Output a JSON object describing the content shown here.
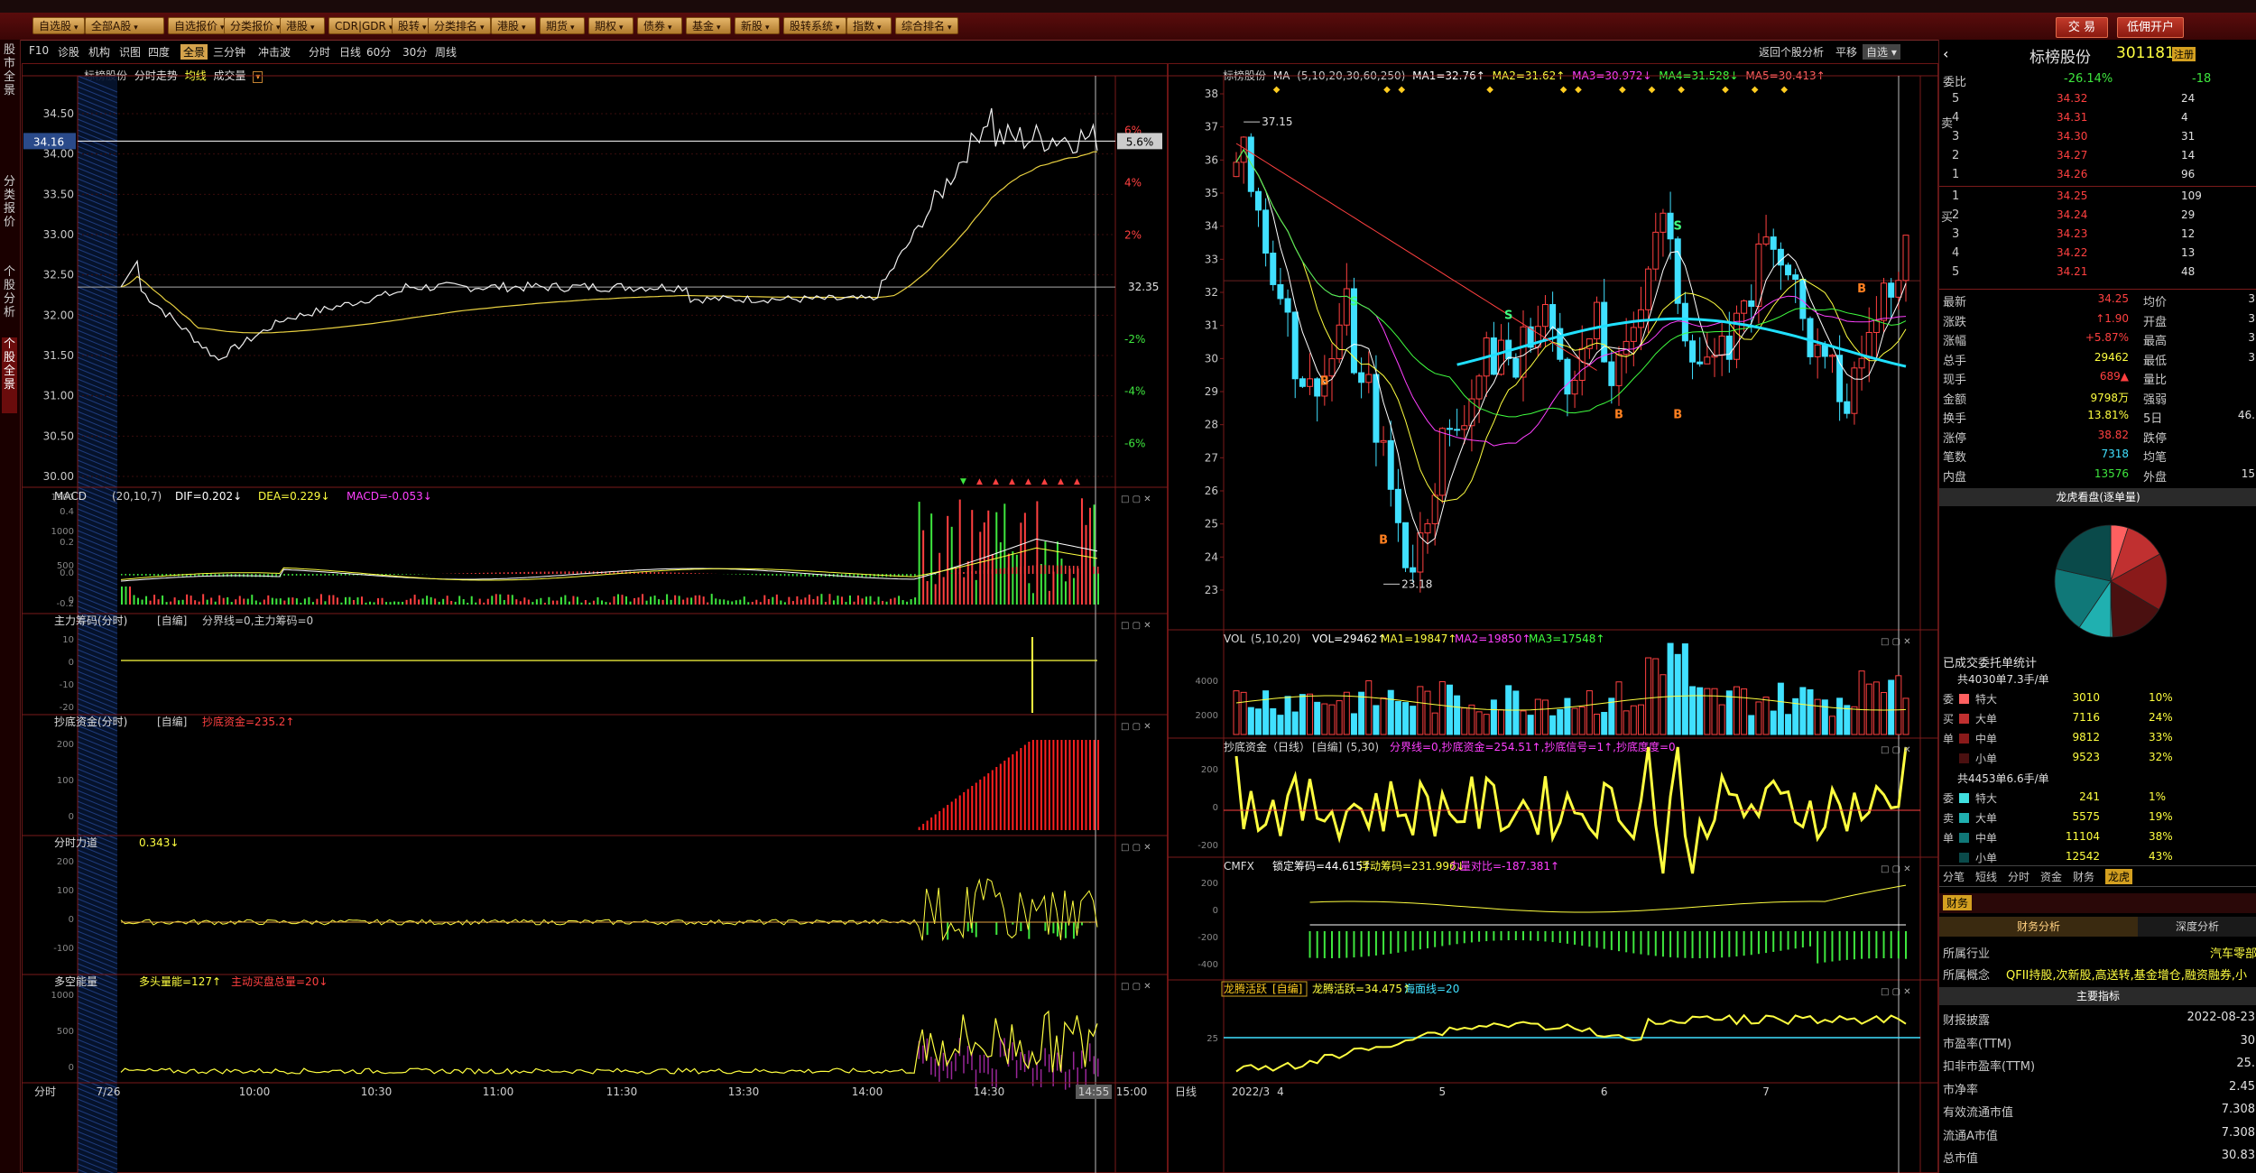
{
  "toolbar": {
    "buttons": [
      "自选股",
      "全部A股",
      "自选报价",
      "分类报价",
      "港股",
      "CDR|GDR",
      "股转",
      "分类排名",
      "港股",
      "期货",
      "期权",
      "债券",
      "基金",
      "新股",
      "股转系统",
      "指数",
      "综合排名"
    ],
    "trade_label": "交 易",
    "margin_label": "低佣开户"
  },
  "sidebar": {
    "tabs": [
      "股市全景",
      "分类报价",
      "个股分析",
      "个股全景"
    ],
    "active_index": 3
  },
  "subnav": {
    "left_items": [
      "F10",
      "诊股",
      "机构",
      "识图",
      "四度",
      "全景",
      "三分钟",
      "冲击波",
      "分时",
      "日线",
      "60分",
      "30分",
      "周线"
    ],
    "selected": "全景",
    "right_items": [
      "返回个股分析",
      "平移",
      "自选"
    ]
  },
  "intraday": {
    "title": "标榜股份",
    "subtitle": "分时走势",
    "avg_label": "均线",
    "vol_label": "成交量",
    "current_price": "34.16",
    "current_pct": "5.6%",
    "price_ticks": [
      "34.50",
      "34.00",
      "33.50",
      "33.00",
      "32.50",
      "32.00",
      "31.50",
      "31.00",
      "30.50",
      "30.00"
    ],
    "pct_ticks": [
      "6%",
      "4%",
      "2%",
      "-2%",
      "-4%",
      "-6%"
    ],
    "prev_close": "32.35",
    "time_labels": [
      "7/26",
      "10:00",
      "10:30",
      "11:00",
      "11:30",
      "13:30",
      "14:00",
      "14:30",
      "14:55",
      "15:00"
    ],
    "time_left_label": "分时"
  },
  "vol_panel": {
    "ticks": [
      "1500",
      "1000",
      "500",
      "0"
    ]
  },
  "macd_panel": {
    "label": "MACD",
    "params": "(20,10,7)",
    "dif": "DIF=0.202↓",
    "dea": "DEA=0.229↓",
    "macd": "MACD=-0.053↓",
    "ticks": [
      "0.4",
      "0.2",
      "0.0",
      "-0.2"
    ]
  },
  "zljm_panel": {
    "label": "主力筹码(分时)",
    "mode": "[自编]",
    "text": "分界线=0,主力筹码=0",
    "ticks": [
      "10",
      "0",
      "-10",
      "-20"
    ]
  },
  "cdzj_panel": {
    "label": "抄底资金(分时)",
    "mode": "[自编]",
    "text": "抄底资金=235.2↑",
    "ticks": [
      "200",
      "100",
      "0"
    ]
  },
  "fsld_panel": {
    "label": "分时力道",
    "text": "0.343↓",
    "ticks": [
      "200",
      "100",
      "0",
      "-100"
    ]
  },
  "dknl_panel": {
    "label": "多空能量",
    "text1": "多头量能=127↑",
    "text2": "主动买盘总量=20↓",
    "ticks": [
      "1000",
      "500",
      "0"
    ]
  },
  "kline": {
    "title": "标榜股份",
    "ma_label": "MA",
    "ma_params": "(5,10,20,30,60,250)",
    "ma1": "MA1=32.76↑",
    "ma2": "MA2=31.62↑",
    "ma3": "MA3=30.972↓",
    "ma4": "MA4=31.528↓",
    "ma5": "MA5=30.413↑",
    "price_ticks": [
      "38",
      "37",
      "36",
      "35",
      "34",
      "33",
      "32",
      "31",
      "30",
      "29",
      "28",
      "27",
      "26",
      "25",
      "24",
      "23"
    ],
    "high_label": "37.15",
    "low_label": "23.18",
    "x_labels": [
      "2022/3",
      "4",
      "5",
      "6",
      "7"
    ],
    "x_left_label": "日线"
  },
  "vol_k_panel": {
    "label": "VOL",
    "params": "(5,10,20)",
    "vol": "VOL=29462↑",
    "ma1": "MA1=19847↑",
    "ma2": "MA2=19850↑",
    "ma3": "MA3=17548↑",
    "ticks": [
      "4000",
      "2000"
    ]
  },
  "cdzj_k_panel": {
    "label": "抄底资金（日线）",
    "mode": "[自编]",
    "params": "(5,30)",
    "text": "分界线=0,抄底资金=254.51↑,抄底信号=1↑,抄底度度=0",
    "ticks": [
      "200",
      "0",
      "-200"
    ]
  },
  "cmfx_panel": {
    "label": "CMFX",
    "text1": "锁定筹码=44.615↑",
    "text2": "浮动筹码=231.996↓",
    "text3": "力量对比=-187.381↑",
    "ticks": [
      "200",
      "0",
      "-200",
      "-400"
    ]
  },
  "lthy_panel": {
    "label": "龙腾活跃",
    "mode": "[自编]",
    "text1": "龙腾活跃=34.475↑",
    "text2": "海面线=20",
    "ticks": [
      "25"
    ]
  },
  "quote": {
    "name": "标榜股份",
    "code": "301181",
    "badge": "注册",
    "weibi_label": "委比",
    "weibi": "-26.14%",
    "weicha": "-18",
    "sell_label": "卖盘",
    "buy_label": "买盘",
    "asks": [
      {
        "lvl": "5",
        "price": "34.32",
        "vol": "24"
      },
      {
        "lvl": "4",
        "price": "34.31",
        "vol": "4"
      },
      {
        "lvl": "3",
        "price": "34.30",
        "vol": "31"
      },
      {
        "lvl": "2",
        "price": "34.27",
        "vol": "14"
      },
      {
        "lvl": "1",
        "price": "34.26",
        "vol": "96"
      }
    ],
    "bids": [
      {
        "lvl": "1",
        "price": "34.25",
        "vol": "109"
      },
      {
        "lvl": "2",
        "price": "34.24",
        "vol": "29"
      },
      {
        "lvl": "3",
        "price": "34.23",
        "vol": "12"
      },
      {
        "lvl": "4",
        "price": "34.22",
        "vol": "13"
      },
      {
        "lvl": "5",
        "price": "34.21",
        "vol": "48"
      }
    ],
    "stats": [
      {
        "k1": "最新",
        "v1": "34.25",
        "k2": "均价",
        "v2": "3"
      },
      {
        "k1": "涨跌",
        "v1": "↑1.90",
        "k2": "开盘",
        "v2": "3"
      },
      {
        "k1": "涨幅",
        "v1": "+5.87%",
        "k2": "最高",
        "v2": "3"
      },
      {
        "k1": "总手",
        "v1": "29462",
        "k2": "最低",
        "v2": "3"
      },
      {
        "k1": "现手",
        "v1": "689▲",
        "k2": "量比",
        "v2": ""
      },
      {
        "k1": "金额",
        "v1": "9798万",
        "k2": "强弱",
        "v2": ""
      },
      {
        "k1": "换手",
        "v1": "13.81%",
        "k2": "5日",
        "v2": "46."
      },
      {
        "k1": "涨停",
        "v1": "38.82",
        "k2": "跌停",
        "v2": ""
      },
      {
        "k1": "笔数",
        "v1": "7318",
        "k2": "均笔",
        "v2": ""
      },
      {
        "k1": "内盘",
        "v1": "13576",
        "k2": "外盘",
        "v2": "15"
      }
    ],
    "pie_title": "龙虎看盘(逐单量)",
    "orders_title": "已成交委托单统计",
    "buy_total": "共4030单7.3手/单",
    "buy_rows": [
      {
        "side": "委",
        "name": "特大",
        "count": "3010",
        "pct": "10%",
        "color": "#ff6060"
      },
      {
        "side": "买",
        "name": "大单",
        "count": "7116",
        "pct": "24%",
        "color": "#c03030"
      },
      {
        "side": "单",
        "name": "中单",
        "count": "9812",
        "pct": "33%",
        "color": "#8a1a1a"
      },
      {
        "side": "",
        "name": "小单",
        "count": "9523",
        "pct": "32%",
        "color": "#4a1010"
      }
    ],
    "sell_total": "共4453单6.6手/单",
    "sell_rows": [
      {
        "side": "委",
        "name": "特大",
        "count": "241",
        "pct": "1%",
        "color": "#40e0e0"
      },
      {
        "side": "卖",
        "name": "大单",
        "count": "5575",
        "pct": "19%",
        "color": "#20b0b0"
      },
      {
        "side": "单",
        "name": "中单",
        "count": "11104",
        "pct": "38%",
        "color": "#107878"
      },
      {
        "side": "",
        "name": "小单",
        "count": "12542",
        "pct": "43%",
        "color": "#0a4a4a"
      }
    ],
    "tabs": [
      "分笔",
      "短线",
      "分时",
      "资金",
      "财务",
      "龙虎"
    ],
    "active_tab": "龙虎",
    "finance_tag": "财务",
    "fin_tabs": [
      "财务分析",
      "深度分析"
    ],
    "industry_label": "所属行业",
    "industry": "汽车零部",
    "concept_label": "所属概念",
    "concept": "QFII持股,次新股,高送转,基金增仓,融资融券,小",
    "main_index": "主要指标",
    "fin_rows": [
      {
        "k": "财报披露",
        "v": "2022-08-23"
      },
      {
        "k": "市盈率(TTM)",
        "v": "30"
      },
      {
        "k": "扣非市盈率(TTM)",
        "v": "25."
      },
      {
        "k": "市净率",
        "v": "2.45"
      },
      {
        "k": "有效流通市值",
        "v": "7.308"
      },
      {
        "k": "流通A市值",
        "v": "7.308"
      },
      {
        "k": "总市值",
        "v": "30.83"
      }
    ]
  },
  "pie": {
    "slices": [
      {
        "value": 10,
        "color": "#ff6060"
      },
      {
        "value": 24,
        "color": "#c03030"
      },
      {
        "value": 33,
        "color": "#8a1a1a"
      },
      {
        "value": 32,
        "color": "#4a1010"
      },
      {
        "value": 1,
        "color": "#40e0e0"
      },
      {
        "value": 19,
        "color": "#20b0b0"
      },
      {
        "value": 38,
        "color": "#107878"
      },
      {
        "value": 43,
        "color": "#0a4a4a"
      }
    ]
  }
}
